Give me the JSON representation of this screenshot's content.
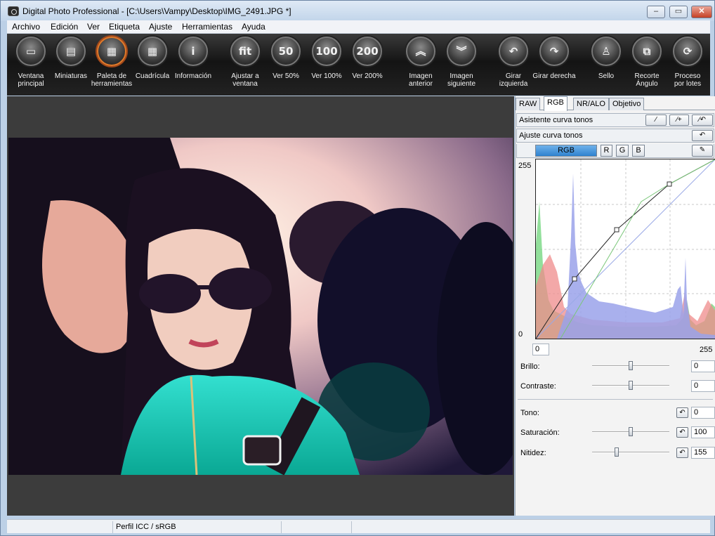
{
  "window": {
    "title": "Digital Photo Professional - [C:\\Users\\Vampy\\Desktop\\IMG_2491.JPG *]",
    "minimize": "–",
    "maximize": "▭",
    "close": "✕"
  },
  "menu": [
    "Archivo",
    "Edición",
    "Ver",
    "Etiqueta",
    "Ajuste",
    "Herramientas",
    "Ayuda"
  ],
  "toolbar": {
    "items": [
      {
        "label": "Ventana\nprincipal",
        "icon": "folder-icon",
        "glyph": "▭"
      },
      {
        "label": "Miniaturas",
        "icon": "thumbnails-icon",
        "glyph": "▤"
      },
      {
        "label": "Paleta de\nherramientas",
        "icon": "tool-palette-icon",
        "glyph": "▦"
      },
      {
        "label": "Cuadrícula",
        "icon": "grid-icon",
        "glyph": "▦"
      },
      {
        "label": "Información",
        "icon": "info-icon",
        "glyph": "i"
      },
      {
        "label": "Ajustar a\nventana",
        "icon": "fit-icon",
        "glyph": "fit"
      },
      {
        "label": "Ver 50%",
        "icon": "zoom-50-icon",
        "glyph": "50"
      },
      {
        "label": "Ver 100%",
        "icon": "zoom-100-icon",
        "glyph": "100"
      },
      {
        "label": "Ver 200%",
        "icon": "zoom-200-icon",
        "glyph": "200"
      },
      {
        "label": "Imagen\nanterior",
        "icon": "previous-image-icon",
        "glyph": "︽"
      },
      {
        "label": "Imagen\nsiguiente",
        "icon": "next-image-icon",
        "glyph": "︾"
      },
      {
        "label": "Girar izquierda",
        "icon": "rotate-left-icon",
        "glyph": "↶"
      },
      {
        "label": "Girar derecha",
        "icon": "rotate-right-icon",
        "glyph": "↷"
      },
      {
        "label": "Sello",
        "icon": "stamp-icon",
        "glyph": "♙"
      },
      {
        "label": "Recorte\nÁngulo",
        "icon": "crop-angle-icon",
        "glyph": "⧉"
      },
      {
        "label": "Proceso\npor lotes",
        "icon": "batch-process-icon",
        "glyph": "⟳"
      }
    ],
    "active_index": 2,
    "accent": "#e07a2a"
  },
  "panel": {
    "tabs": [
      "RAW",
      "RGB",
      "NR/ALO",
      "Objetivo"
    ],
    "active_tab": 1,
    "tone_curve_assist": "Asistente curva tonos",
    "tone_curve_adjust": "Ajuste curva tonos",
    "channels": [
      "RGB",
      "R",
      "G",
      "B"
    ],
    "active_channel": "RGB",
    "curve": {
      "y_max": "255",
      "y_min": "0",
      "x_min": "0",
      "x_max": "255"
    },
    "controls": {
      "brightness": {
        "label": "Brillo:",
        "value": "0",
        "level": 0.5
      },
      "contrast": {
        "label": "Contraste:",
        "value": "0",
        "level": 0.5
      },
      "hue": {
        "label": "Tono:",
        "value": "0"
      },
      "saturation": {
        "label": "Saturación:",
        "value": "100",
        "level": 0.5
      },
      "sharpness": {
        "label": "Nitidez:",
        "value": "155",
        "level": 0.32
      }
    }
  },
  "status": {
    "icc_profile": "Perfil ICC / sRGB"
  }
}
